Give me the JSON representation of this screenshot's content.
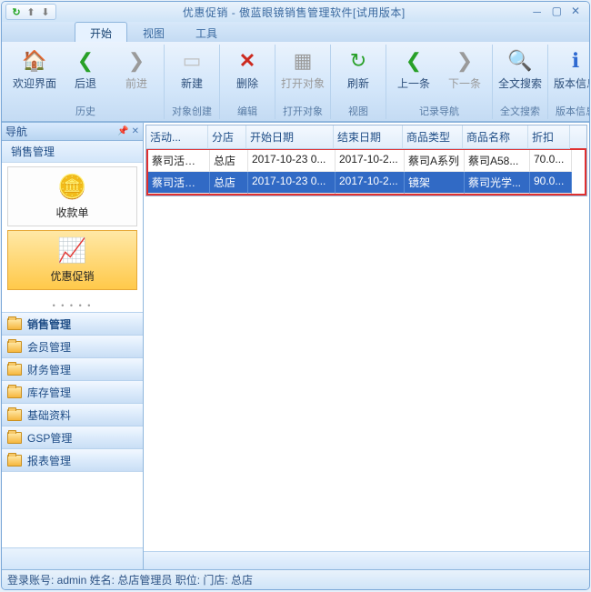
{
  "window": {
    "title": "优惠促销 - 傲蓝眼镜销售管理软件[试用版本]"
  },
  "qat": {
    "refresh_icon": "↻",
    "up_icon": "⬆",
    "down_icon": "⬇"
  },
  "tabs": {
    "t0": "开始",
    "t1": "视图",
    "t2": "工具"
  },
  "ribbon": {
    "history": {
      "title": "历史",
      "welcome": "欢迎界面",
      "back": "后退",
      "forward": "前进"
    },
    "create": {
      "title": "对象创建",
      "new": "新建"
    },
    "edit": {
      "title": "编辑",
      "del": "删除"
    },
    "open": {
      "title": "打开对象",
      "open": "打开对象"
    },
    "view": {
      "title": "视图",
      "refresh": "刷新"
    },
    "nav": {
      "title": "记录导航",
      "prev": "上一条",
      "next": "下一条"
    },
    "search": {
      "title": "全文搜索",
      "search": "全文搜索"
    },
    "version": {
      "title": "版本信息",
      "version": "版本信息"
    }
  },
  "nav": {
    "header": "导航",
    "subheader": "销售管理",
    "items": {
      "0": {
        "label": "收款单"
      },
      "1": {
        "label": "优惠促销"
      }
    },
    "stacks": {
      "0": "销售管理",
      "1": "会员管理",
      "2": "财务管理",
      "3": "库存管理",
      "4": "基础资料",
      "5": "GSP管理",
      "6": "报表管理"
    }
  },
  "grid": {
    "cols": {
      "0": "活动...",
      "1": "分店",
      "2": "开始日期",
      "3": "结束日期",
      "4": "商品类型",
      "5": "商品名称",
      "6": "折扣"
    },
    "rows": [
      {
        "c0": "蔡司活动日",
        "c1": "总店",
        "c2": "2017-10-23 0...",
        "c3": "2017-10-2...",
        "c4": "蔡司A系列",
        "c5": "蔡司A58...",
        "c6": "70.0..."
      },
      {
        "c0": "蔡司活动日",
        "c1": "总店",
        "c2": "2017-10-23 0...",
        "c3": "2017-10-2...",
        "c4": "镜架",
        "c5": "蔡司光学...",
        "c6": "90.0..."
      }
    ]
  },
  "status": {
    "text": "登录账号: admin   姓名: 总店管理员   职位:    门店: 总店"
  }
}
